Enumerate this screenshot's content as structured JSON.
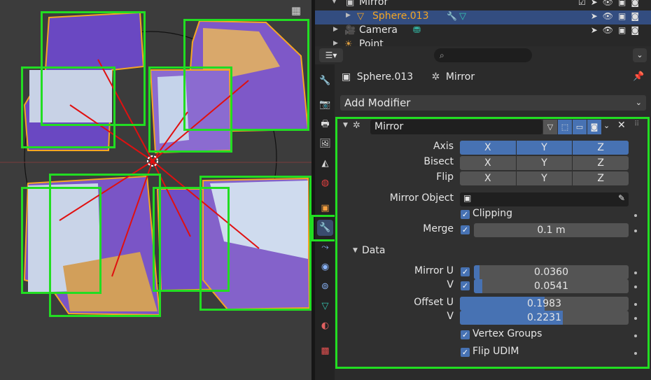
{
  "outliner": {
    "rows": [
      {
        "name": "Mirror",
        "icon": "object-icon",
        "selected": false
      },
      {
        "name": "Sphere.013",
        "icon": "mesh-icon",
        "selected": true
      },
      {
        "name": "Camera",
        "icon": "camera-icon",
        "selected": false
      },
      {
        "name": "Point",
        "icon": "light-icon",
        "selected": false
      }
    ]
  },
  "properties": {
    "search_placeholder": "",
    "breadcrumb_object": "Sphere.013",
    "breadcrumb_modifier": "Mirror",
    "add_modifier": "Add Modifier",
    "modifier": {
      "name": "Mirror",
      "axis_label": "Axis",
      "bisect_label": "Bisect",
      "flip_label": "Flip",
      "axis_x": "X",
      "axis_y": "Y",
      "axis_z": "Z",
      "axis_active": [
        true,
        true,
        true
      ],
      "mirror_object_label": "Mirror Object",
      "clipping_label": "Clipping",
      "merge_label": "Merge",
      "merge_value": "0.1 m",
      "data_section": "Data",
      "mirror_u_label": "Mirror U",
      "mirror_u_value": "0.0360",
      "v_label": "V",
      "mirror_v_value": "0.0541",
      "offset_u_label": "Offset U",
      "offset_u_value": "0.1983",
      "offset_v_value": "0.2231",
      "vertex_groups_label": "Vertex Groups",
      "flip_udim_label": "Flip UDIM"
    },
    "fill_fractions": {
      "mirror_u": 0.036,
      "mirror_v": 0.054,
      "offset_u": 0.5,
      "offset_v": 0.61
    }
  },
  "colors": {
    "accent_blue": "#4772b3",
    "selection_green": "#22dd22",
    "highlight_orange": "#f5a623"
  }
}
